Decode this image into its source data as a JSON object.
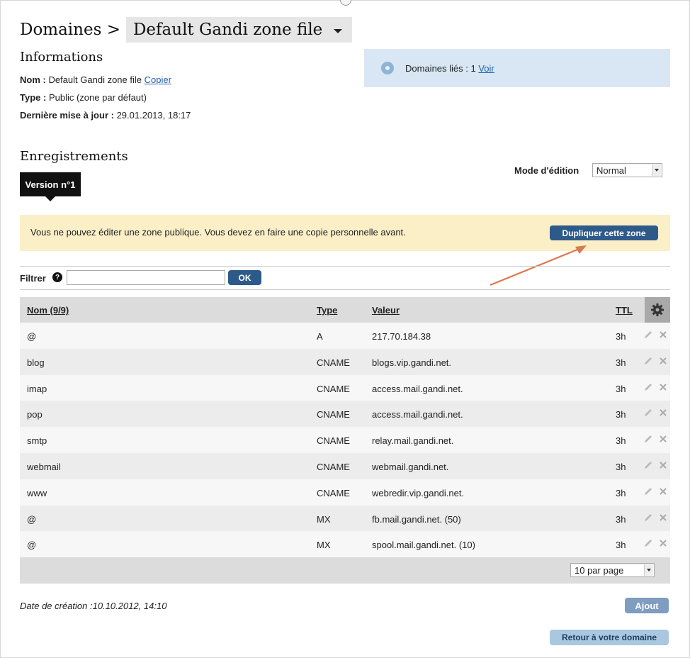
{
  "header": {
    "breadcrumb_root": "Domaines >",
    "zone_name": "Default Gandi zone file"
  },
  "informations": {
    "title": "Informations",
    "nom_label": "Nom :",
    "nom_value": "Default Gandi zone file",
    "copy_link": "Copier",
    "type_label": "Type :",
    "type_value": "Public (zone par défaut)",
    "update_label": "Dernière mise à jour :",
    "update_value": "29.01.2013, 18:17"
  },
  "linked_domains": {
    "text": "Domaines liés : 1",
    "link": "Voir"
  },
  "records": {
    "title": "Enregistrements",
    "version_tab": "Version n°1",
    "mode_label": "Mode d'édition",
    "mode_value": "Normal"
  },
  "warning": {
    "text": "Vous ne pouvez éditer une zone publique. Vous devez en faire une copie personnelle avant.",
    "button": "Dupliquer cette zone"
  },
  "filter": {
    "label": "Filtrer",
    "help": "?",
    "value": "",
    "button": "OK"
  },
  "table": {
    "columns": {
      "name": "Nom",
      "name_count": "(9/9)",
      "type": "Type",
      "value": "Valeur",
      "ttl": "TTL"
    },
    "rows": [
      {
        "name": "@",
        "type": "A",
        "value": "217.70.184.38",
        "ttl": "3h"
      },
      {
        "name": "blog",
        "type": "CNAME",
        "value": "blogs.vip.gandi.net.",
        "ttl": "3h"
      },
      {
        "name": "imap",
        "type": "CNAME",
        "value": "access.mail.gandi.net.",
        "ttl": "3h"
      },
      {
        "name": "pop",
        "type": "CNAME",
        "value": "access.mail.gandi.net.",
        "ttl": "3h"
      },
      {
        "name": "smtp",
        "type": "CNAME",
        "value": "relay.mail.gandi.net.",
        "ttl": "3h"
      },
      {
        "name": "webmail",
        "type": "CNAME",
        "value": "webmail.gandi.net.",
        "ttl": "3h"
      },
      {
        "name": "www",
        "type": "CNAME",
        "value": "webredir.vip.gandi.net.",
        "ttl": "3h"
      },
      {
        "name": "@",
        "type": "MX",
        "value": "fb.mail.gandi.net. (50)",
        "ttl": "3h"
      },
      {
        "name": "@",
        "type": "MX",
        "value": "spool.mail.gandi.net. (10)",
        "ttl": "3h"
      }
    ],
    "page_size": "10 par page"
  },
  "footer": {
    "created": "Date de création :10.10.2012, 14:10",
    "add_button": "Ajout",
    "back_button": "Retour à votre domaine"
  },
  "colors": {
    "primary_button": "#2e5a8a",
    "warning_bg": "#fbefc8",
    "info_bg": "#d8e7f3",
    "annotation_arrow": "#d9794f"
  }
}
